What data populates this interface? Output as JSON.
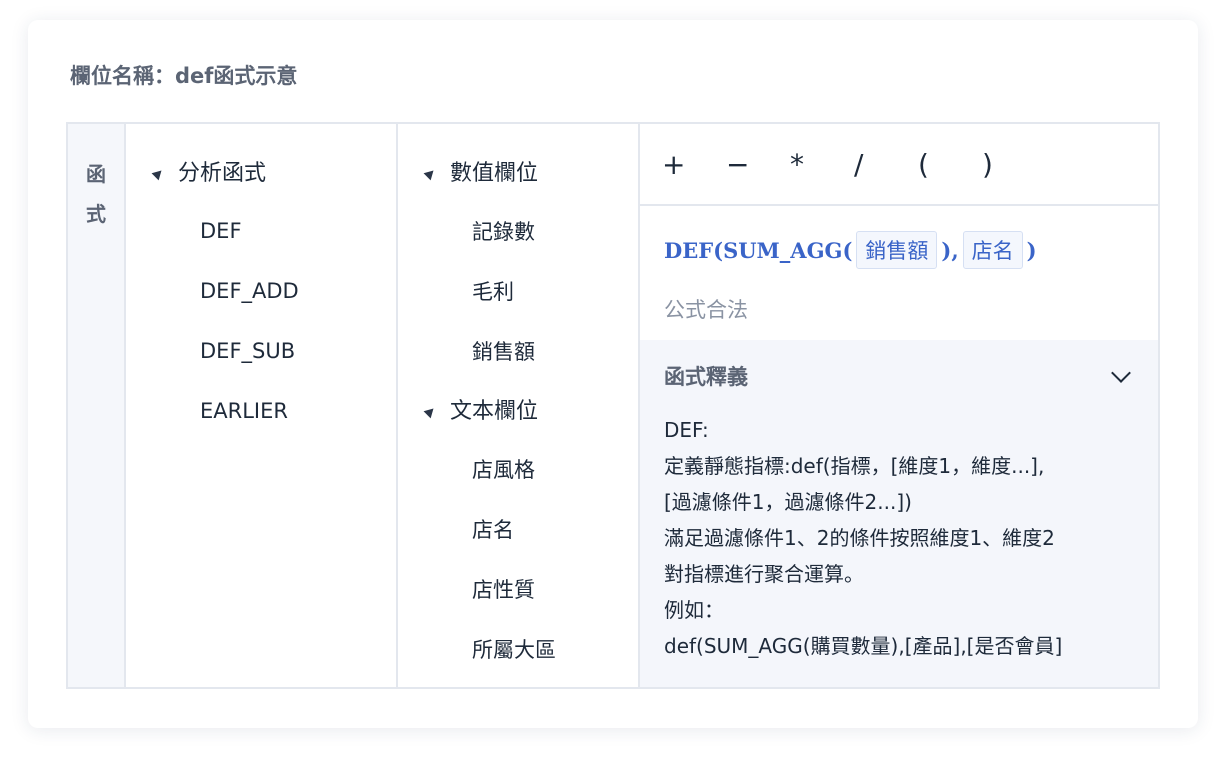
{
  "header": {
    "field_name_label": "欄位名稱：def函式示意"
  },
  "sidebar_label": {
    "chars": [
      "函",
      "式"
    ]
  },
  "functions": {
    "group_label": "分析函式",
    "items": [
      "DEF",
      "DEF_ADD",
      "DEF_SUB",
      "EARLIER"
    ]
  },
  "fields": {
    "groups": [
      {
        "label": "數值欄位",
        "items": [
          "記錄數",
          "毛利",
          "銷售額"
        ]
      },
      {
        "label": "文本欄位",
        "items": [
          "店風格",
          "店名",
          "店性質",
          "所屬大區"
        ]
      }
    ]
  },
  "operators": [
    "+",
    "−",
    "*",
    "/",
    "(",
    ")"
  ],
  "formula": {
    "prefix": "DEF(SUM_AGG(",
    "chip1": "銷售額",
    "middle": "),",
    "chip2": "店名",
    "suffix": ")",
    "status": "公式合法"
  },
  "explanation": {
    "title": "函式釋義",
    "lines": [
      "DEF:",
      "定義靜態指標:def(指標，[維度1，維度...],",
      "[過濾條件1，過濾條件2...])",
      "滿足過濾條件1、2的條件按照維度1、維度2",
      "對指標進行聚合運算。",
      "例如：",
      "def(SUM_AGG(購買數量),[產品],[是否會員]"
    ]
  },
  "colors": {
    "accent": "#3a64c8",
    "border": "#e3e7ee",
    "panel_bg": "#f4f6fb",
    "muted_text": "#8a93a3"
  }
}
